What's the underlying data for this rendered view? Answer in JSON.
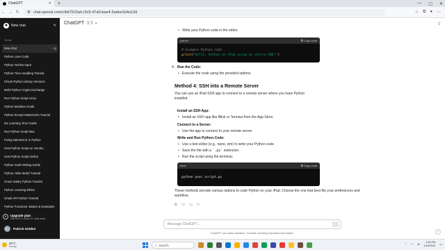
{
  "browser": {
    "tab_title": "ChatGPT",
    "tab_close": "✕",
    "new_tab": "+",
    "url": "chat.openai.com/c/b67515af-c3c5-47a0-bae4-2adee1b4a13d",
    "window_controls": [
      "—",
      "▢",
      "✕"
    ]
  },
  "sidebar": {
    "new_chat": "New chat",
    "section_label": "Today",
    "items": [
      "New chat",
      "Python Love Code",
      "Python Yes/No Input",
      "Python Time Handling Tutorial",
      "Check Python Library Versions",
      "Build Python Crypto Exchange",
      "Run Python Script Linux",
      "Python Modules Guide",
      "Python Except Statements Tutorial",
      "ML Learning Time Guide",
      "Run Python Script Mac",
      "Fixing NameError in Python",
      "Host Python Script on Heroku",
      "Host Python Script Online",
      "Python Code Writing Guide",
      "Python Hello World Tutorial",
      "Gross Salary Python Tutorial",
      "Python Learning Ethics",
      "Gmail API Python Tutorial",
      "Python Functions: Basics & Examples"
    ],
    "active_index": 0,
    "upgrade_title": "Upgrade plan",
    "upgrade_sub": "Get GPT-4, DALL·E, and more",
    "user_initials": "PG",
    "user_name": "Patrick Golden"
  },
  "header": {
    "title": "ChatGPT",
    "version": "3.5"
  },
  "content": {
    "line1": "Write your Python code in the editor.",
    "code1_lang": "python",
    "copy_label": "Copy code",
    "code1_comment": "# Example Python code",
    "code1_fn": "print",
    "code1_str": "\"Hello, Python on iPad using an online IDE!\"",
    "step4_num": "4.",
    "step4_title": "Run the Code:",
    "step4_bullet": "Execute the code using the provided options.",
    "method4_heading": "Method 4: SSH into a Remote Server",
    "method4_para": "You can use an iPad SSH app to connect to a remote server where you have Python installed.",
    "s1_title": "Install an SSH App:",
    "s1_bullet": "Install an SSH app like Blink or Termius from the App Store.",
    "s2_title": "Connect to a Server:",
    "s2_bullet": "Use the app to connect to your remote server.",
    "s3_title": "Write and Run Python Code:",
    "s3_b1": "Use a text editor (e.g., nano, vim) to write your Python code.",
    "s3_b2_pre": "Save the file with a ",
    "s3_b2_code": "`.py`",
    "s3_b2_post": " extension.",
    "s3_b3": "Run the script using the terminal.",
    "code2_lang": "bash",
    "code2_line": "python your_script.py",
    "closing": "These methods provide various options to code Python on your iPad. Choose the one that best fits your preferences and workflow."
  },
  "composer": {
    "placeholder": "Message ChatGPT…",
    "disclaimer": "ChatGPT can make mistakes. Consider checking important information.",
    "help": "?"
  },
  "taskbar": {
    "temp": "25°C",
    "condition": "Sunny",
    "search": "Search",
    "time": "1:35 PM",
    "date": "1/15/2024"
  }
}
